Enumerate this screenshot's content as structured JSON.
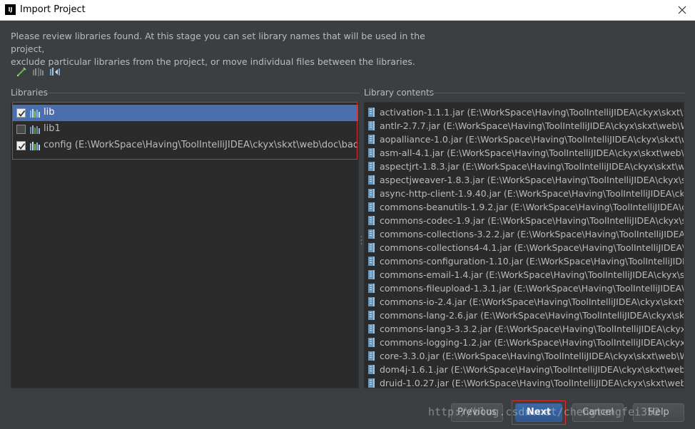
{
  "window": {
    "title": "Import Project",
    "app_icon_text": "IJ"
  },
  "description": {
    "line1": "Please review libraries found. At this stage you can set library names that will be used in the project,",
    "line2": "exclude particular libraries from the project, or move individual files between the libraries."
  },
  "toolbar": {
    "icons": [
      "pencil-edit-icon",
      "split-library-icon",
      "move-to-library-icon"
    ]
  },
  "libraries": {
    "label": "Libraries",
    "items": [
      {
        "label": "lib",
        "checked": true,
        "selected": true
      },
      {
        "label": "lib1",
        "checked": false,
        "selected": false
      },
      {
        "label": "config (E:\\WorkSpace\\Having\\ToolIntelliJIDEA\\ckyx\\skxt\\web\\doc\\backup)",
        "checked": true,
        "selected": false
      }
    ]
  },
  "library_contents": {
    "label": "Library contents",
    "items": [
      "activation-1.1.1.jar (E:\\WorkSpace\\Having\\ToolIntelliJIDEA\\ckyx\\skxt\\web\\",
      "antlr-2.7.7.jar (E:\\WorkSpace\\Having\\ToolIntelliJIDEA\\ckyx\\skxt\\web\\Web",
      "aopalliance-1.0.jar (E:\\WorkSpace\\Having\\ToolIntelliJIDEA\\ckyx\\skxt\\web\\Web",
      "asm-all-4.1.jar (E:\\WorkSpace\\Having\\ToolIntelliJIDEA\\ckyx\\skxt\\web\\Web",
      "aspectjrt-1.8.3.jar (E:\\WorkSpace\\Having\\ToolIntelliJIDEA\\ckyx\\skxt\\web\\",
      "aspectjweaver-1.8.3.jar (E:\\WorkSpace\\Having\\ToolIntelliJIDEA\\ckyx\\skxt\\",
      "async-http-client-1.9.40.jar (E:\\WorkSpace\\Having\\ToolIntelliJIDEA\\ckyx\\s",
      "commons-beanutils-1.9.2.jar (E:\\WorkSpace\\Having\\ToolIntelliJIDEA\\ckyx\\",
      "commons-codec-1.9.jar (E:\\WorkSpace\\Having\\ToolIntelliJIDEA\\ckyx\\skxt\\",
      "commons-collections-3.2.2.jar (E:\\WorkSpace\\Having\\ToolIntelliJIDEA\\cky",
      "commons-collections4-4.1.jar (E:\\WorkSpace\\Having\\ToolIntelliJIDEA\\ckyx",
      "commons-configuration-1.10.jar (E:\\WorkSpace\\Having\\ToolIntelliJIDEA\\c",
      "commons-email-1.4.jar (E:\\WorkSpace\\Having\\ToolIntelliJIDEA\\ckyx\\skxt\\",
      "commons-fileupload-1.3.1.jar (E:\\WorkSpace\\Having\\ToolIntelliJIDEA\\cky",
      "commons-io-2.4.jar (E:\\WorkSpace\\Having\\ToolIntelliJIDEA\\ckyx\\skxt\\web",
      "commons-lang-2.6.jar (E:\\WorkSpace\\Having\\ToolIntelliJIDEA\\ckyx\\skxt\\",
      "commons-lang3-3.3.2.jar (E:\\WorkSpace\\Having\\ToolIntelliJIDEA\\ckyx\\sk",
      "commons-logging-1.2.jar (E:\\WorkSpace\\Having\\ToolIntelliJIDEA\\ckyx\\skxt",
      "core-3.3.0.jar (E:\\WorkSpace\\Having\\ToolIntelliJIDEA\\ckyx\\skxt\\web\\Web",
      "dom4j-1.6.1.jar (E:\\WorkSpace\\Having\\ToolIntelliJIDEA\\ckyx\\skxt\\web\\Web",
      "druid-1.0.27.jar (E:\\WorkSpace\\Having\\ToolIntelliJIDEA\\ckyx\\skxt\\web\\We"
    ]
  },
  "buttons": {
    "previous": "Previous",
    "next": "Next",
    "cancel": "Cancel",
    "help": "Help"
  },
  "watermark": "http://blog.csdn.net/chengtengfei352"
}
